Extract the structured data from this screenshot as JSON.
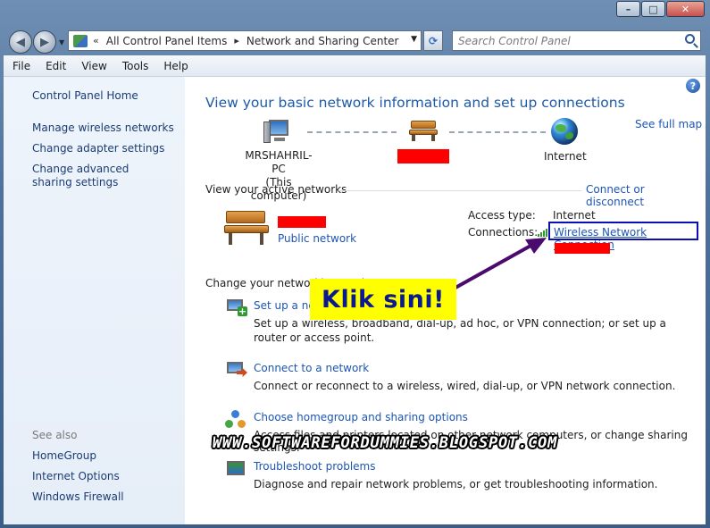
{
  "window": {
    "minimize_glyph": "–",
    "maximize_glyph": "□",
    "close_glyph": "✕"
  },
  "nav": {
    "back_glyph": "◀",
    "forward_glyph": "▶",
    "recent_glyph": "▼",
    "address_chevron": "«",
    "breadcrumb": [
      "All Control Panel Items",
      "Network and Sharing Center"
    ],
    "breadcrumb_sep": "▸",
    "address_dropdown_glyph": "▼",
    "refresh_glyph": "⟳",
    "search_placeholder": "Search Control Panel"
  },
  "menu": [
    "File",
    "Edit",
    "View",
    "Tools",
    "Help"
  ],
  "sidebar": {
    "home": "Control Panel Home",
    "links": [
      "Manage wireless networks",
      "Change adapter settings",
      "Change advanced sharing settings"
    ],
    "see_also_title": "See also",
    "see_also": [
      "HomeGroup",
      "Internet Options",
      "Windows Firewall"
    ]
  },
  "main": {
    "help_glyph": "?",
    "title": "View your basic network information and set up connections",
    "see_full_map": "See full map",
    "map": {
      "computer_name": "MRSHAHRIL-PC",
      "computer_sub": "(This computer)",
      "internet": "Internet"
    },
    "active_networks": {
      "heading": "View your active networks",
      "connect_link": "Connect or disconnect",
      "network_type": "Public network",
      "access_type_label": "Access type:",
      "access_type_value": "Internet",
      "connections_label": "Connections:",
      "connection_name": "Wireless Network Connection"
    },
    "change_settings": {
      "heading": "Change your networking settings",
      "tasks": [
        {
          "title": "Set up a new connection or network",
          "desc": "Set up a wireless, broadband, dial-up, ad hoc, or VPN connection; or set up a router or access point."
        },
        {
          "title": "Connect to a network",
          "desc": "Connect or reconnect to a wireless, wired, dial-up, or VPN network connection."
        },
        {
          "title": "Choose homegroup and sharing options",
          "desc": "Access files and printers located on other network computers, or change sharing settings."
        },
        {
          "title": "Troubleshoot problems",
          "desc": "Diagnose and repair network problems, or get troubleshooting information."
        }
      ]
    }
  },
  "overlay": {
    "callout": "Klik sini!",
    "watermark": "WWW.SOFTWAREFORDUMMIES.BLOGSPOT.COM",
    "redact_color": "#ff0000",
    "callout_color": "#ffff00",
    "highlight_color": "#0a0fb8",
    "arrow_color": "#4b0a6e"
  }
}
